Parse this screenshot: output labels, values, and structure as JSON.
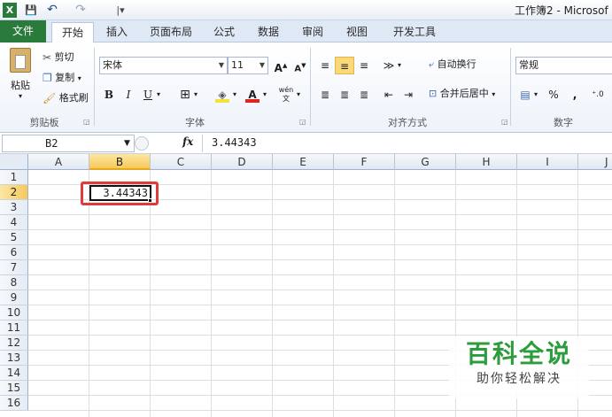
{
  "window": {
    "title": "工作簿2 - Microsof"
  },
  "quick_access": {
    "save": "💾",
    "undo": "↶",
    "redo": "↷",
    "customize": "|▾"
  },
  "tabs": [
    {
      "label": "文件",
      "key": "file"
    },
    {
      "label": "开始",
      "key": "home"
    },
    {
      "label": "插入",
      "key": "insert"
    },
    {
      "label": "页面布局",
      "key": "layout"
    },
    {
      "label": "公式",
      "key": "formulas"
    },
    {
      "label": "数据",
      "key": "data"
    },
    {
      "label": "审阅",
      "key": "review"
    },
    {
      "label": "视图",
      "key": "view"
    },
    {
      "label": "开发工具",
      "key": "developer"
    }
  ],
  "ribbon": {
    "clipboard": {
      "paste": "粘贴",
      "cut": "剪切",
      "copy": "复制",
      "format_painter": "格式刷",
      "group": "剪贴板"
    },
    "font": {
      "name": "宋体",
      "size": "11",
      "bold": "B",
      "italic": "I",
      "underline": "U",
      "grow": "A",
      "shrink": "A",
      "phonetic": "wén",
      "group": "字体"
    },
    "alignment": {
      "wrap": "自动换行",
      "merge": "合并后居中",
      "group": "对齐方式"
    },
    "number": {
      "format": "常规",
      "percent": "%",
      "comma": ",",
      "group": "数字"
    }
  },
  "formula_bar": {
    "name_box": "B2",
    "fx": "fx",
    "content": "3.44343"
  },
  "sheet": {
    "columns": [
      "A",
      "B",
      "C",
      "D",
      "E",
      "F",
      "G",
      "H",
      "I",
      "J"
    ],
    "rows": [
      "1",
      "2",
      "3",
      "4",
      "5",
      "6",
      "7",
      "8",
      "9",
      "10",
      "11",
      "12",
      "13",
      "14",
      "15",
      "16"
    ],
    "selected_col": "B",
    "selected_row": "2",
    "active_cell_value": "3.44343"
  },
  "watermark": {
    "title": "百科全说",
    "subtitle": "助你轻松解决"
  },
  "colors": {
    "file_tab": "#2a7a3b",
    "highlight": "#e03a3a",
    "selection_header": "#f6c95a",
    "watermark": "#2d9c3c"
  }
}
